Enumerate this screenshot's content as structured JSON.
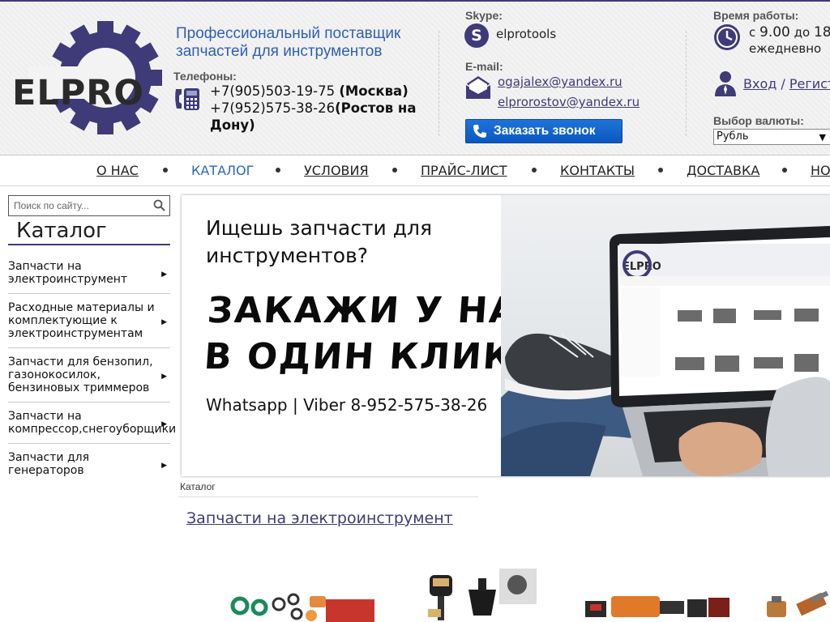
{
  "brand": {
    "logo_text": "ELPRO",
    "tagline_line1": "Профессиональный поставщик",
    "tagline_line2": "запчастей для инструментов",
    "accent": "#3f3a78",
    "link_blue": "#2f5fb4"
  },
  "contacts": {
    "phones_label": "Телефоны:",
    "phone1": "+7(905)503-19-75",
    "phone1_city": "(Москва)",
    "phone2": "+7(952)575-38-26",
    "phone2_city": "(Ростов на Дону)",
    "skype_label": "Skype:",
    "skype_name": "elprotools",
    "email_label": "E-mail:",
    "email1": "ogajalex@yandex.ru",
    "email2": "elprorostov@yandex.ru",
    "callback_button": "Заказать звонок",
    "hours_label": "Время работы:",
    "hours_from": "с ",
    "hours_from_time": "9.00",
    "hours_to": " до ",
    "hours_to_time": "18",
    "hours_days": "ежедневно"
  },
  "account": {
    "login": "Вход",
    "separator": " / ",
    "register": "Регист"
  },
  "currency": {
    "label": "Выбор валюты:",
    "selected": "Рубль"
  },
  "nav": {
    "items": [
      "О НАС",
      "КАТАЛОГ",
      "УСЛОВИЯ",
      "ПРАЙС-ЛИСТ",
      "КОНТАКТЫ",
      "ДОСТАВКА",
      "НО"
    ],
    "active_index": 1
  },
  "sidebar": {
    "search_placeholder": "Поиск по сайту...",
    "catalog_title": "Каталог",
    "items": [
      "Запчасти на электроинструмент",
      "Расходные материалы и комплектующие к электроинструментам",
      "Запчасти для бензопил, газонокосилок, бензиновых триммеров",
      "Запчасти на компрессор,снегоуборщики",
      "Запчасти для генераторов"
    ]
  },
  "banner": {
    "line1": "Ищешь запчасти для",
    "line2": "инструментов?",
    "line3": "ЗАКАЖИ У НАС",
    "line4": "В ОДИН КЛИК→",
    "line5": "Whatsapp | Viber 8-952-575-38-26"
  },
  "main": {
    "breadcrumb": "Каталог",
    "section_title": "Запчасти на электроинструмент"
  }
}
